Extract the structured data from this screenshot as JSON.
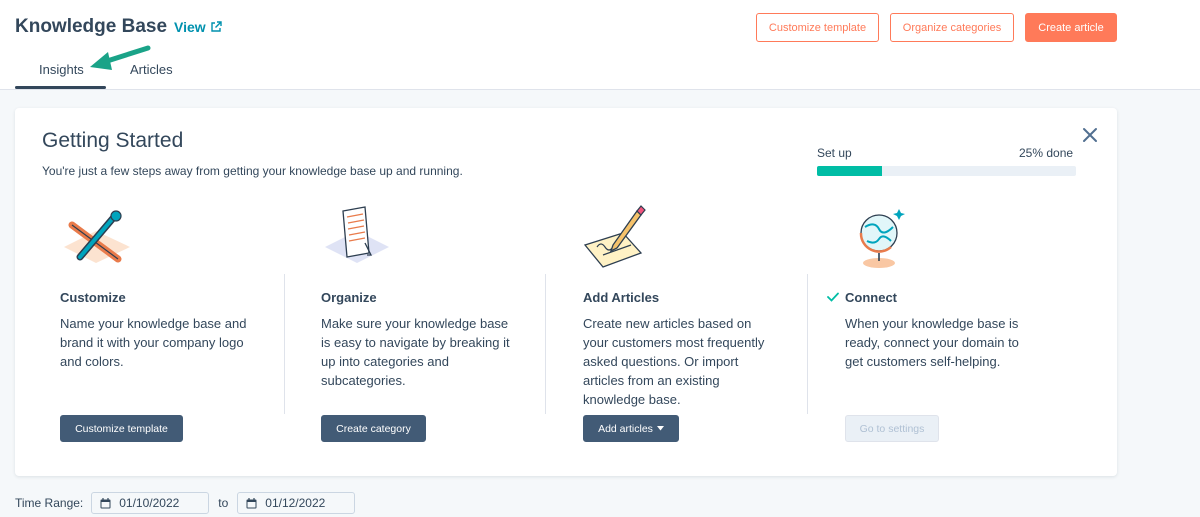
{
  "header": {
    "title": "Knowledge Base",
    "view_label": "View",
    "customize_template_label": "Customize template",
    "organize_categories_label": "Organize categories",
    "create_article_label": "Create article"
  },
  "tabs": [
    {
      "label": "Insights",
      "active": true
    },
    {
      "label": "Articles",
      "active": false
    }
  ],
  "getting_started": {
    "title": "Getting Started",
    "subtitle": "You're just a few steps away from getting your knowledge base up and running.",
    "progress_label": "Set up",
    "progress_text": "25% done",
    "progress_fraction": 0.25,
    "steps": [
      {
        "title": "Customize",
        "description": "Name your knowledge base and brand it with your company logo and colors.",
        "button_label": "Customize template",
        "completed": false
      },
      {
        "title": "Organize",
        "description": "Make sure your knowledge base is easy to navigate by breaking it up into categories and subcategories.",
        "button_label": "Create category",
        "completed": false
      },
      {
        "title": "Add Articles",
        "description": "Create new articles based on your customers most frequently asked questions. Or import articles from an existing knowledge base.",
        "button_label": "Add articles",
        "completed": false
      },
      {
        "title": "Connect",
        "description": "When your knowledge base is ready, connect your domain to get customers self-helping.",
        "button_label": "Go to settings",
        "completed": true
      }
    ]
  },
  "time_range": {
    "label": "Time Range:",
    "from": "01/10/2022",
    "to_label": "to",
    "to": "01/12/2022"
  },
  "colors": {
    "accent": "#ff7a59",
    "text": "#33475b",
    "link": "#0091ae",
    "progress": "#00bda5",
    "dark_button": "#425b76",
    "annotation_arrow": "#1aa388"
  }
}
